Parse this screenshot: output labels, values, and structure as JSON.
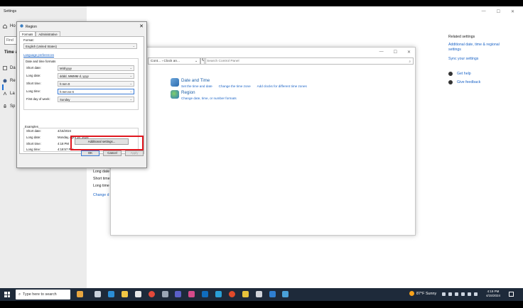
{
  "settings": {
    "title": "Settings",
    "nav_home": "Ho",
    "find_placeholder": "Find",
    "section": "Time &",
    "nav_items": [
      "Da",
      "Re",
      "La",
      "Sp"
    ],
    "related_settings_title": "Related settings",
    "related_links": [
      "Additional date, time & regional settings",
      "Sync your settings"
    ],
    "help_links": [
      "Get help",
      "Give feedback"
    ],
    "bg_rows": [
      "Long date",
      "Short time",
      "Long time"
    ],
    "bg_change_link": "Change d"
  },
  "control_panel": {
    "address": "Cont... › Clock an...",
    "search_placeholder": "Search Control Panel",
    "date_time": {
      "heading": "Date and Time",
      "links": [
        "Set the time and date",
        "Change the time zone",
        "Add clocks for different time zones"
      ]
    },
    "region": {
      "heading": "Region",
      "links": [
        "Change date, time, or number formats"
      ]
    }
  },
  "region_dialog": {
    "title": "Region",
    "tabs": [
      "Formats",
      "Administrative"
    ],
    "format_label": "Format:",
    "format_value": "English (United States)",
    "language_link": "Language preferences",
    "dt_group_label": "Date and time formats",
    "fields": [
      {
        "label": "Short date:",
        "value": "M/d/yyyy"
      },
      {
        "label": "Long date:",
        "value": "dddd, MMMM d, yyyy"
      },
      {
        "label": "Short time:",
        "value": "h:mm tt"
      },
      {
        "label": "Long time:",
        "value": "h:mm:ss tt"
      },
      {
        "label": "First day of week:",
        "value": "Sunday"
      }
    ],
    "examples_label": "Examples",
    "examples": [
      {
        "label": "Short date:",
        "value": "4/15/2024"
      },
      {
        "label": "Long date:",
        "value": "Monday, April 15, 2024"
      },
      {
        "label": "Short time:",
        "value": "4:18 PM"
      },
      {
        "label": "Long time:",
        "value": "4:18:57 PM"
      }
    ],
    "additional_settings": "Additional settings...",
    "ok": "OK",
    "cancel": "Cancel",
    "apply": "Apply"
  },
  "taskbar": {
    "search_placeholder": "Type here to search",
    "weather": "87°F  Sunny",
    "time": "4:19 PM",
    "date": "4/15/2024"
  }
}
